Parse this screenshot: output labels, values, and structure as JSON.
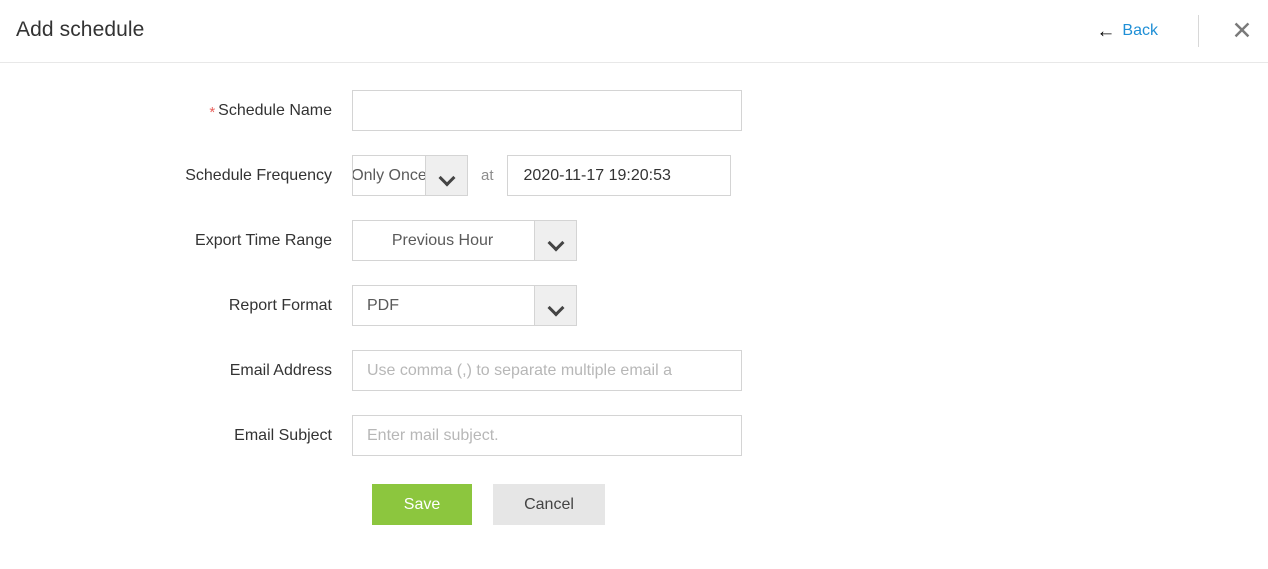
{
  "header": {
    "title": "Add schedule",
    "back_label": "Back",
    "back_arrow_glyph": "←",
    "close_glyph": "✕",
    "accent_link_color": "#1f8fd6"
  },
  "form": {
    "schedule_name": {
      "label": "Schedule Name",
      "required_marker": "*",
      "value": "",
      "placeholder": ""
    },
    "schedule_frequency": {
      "label": "Schedule Frequency",
      "selected": "Only Once",
      "at_label": "at",
      "datetime_value": "2020-11-17 19:20:53"
    },
    "export_time_range": {
      "label": "Export Time Range",
      "selected": "Previous Hour"
    },
    "report_format": {
      "label": "Report Format",
      "selected": "PDF"
    },
    "email_address": {
      "label": "Email Address",
      "value": "",
      "placeholder": "Use comma (,) to separate multiple email a"
    },
    "email_subject": {
      "label": "Email Subject",
      "value": "",
      "placeholder": "Enter mail subject."
    }
  },
  "actions": {
    "save_label": "Save",
    "cancel_label": "Cancel",
    "save_color": "#8cc63e",
    "cancel_color": "#e6e6e6"
  }
}
